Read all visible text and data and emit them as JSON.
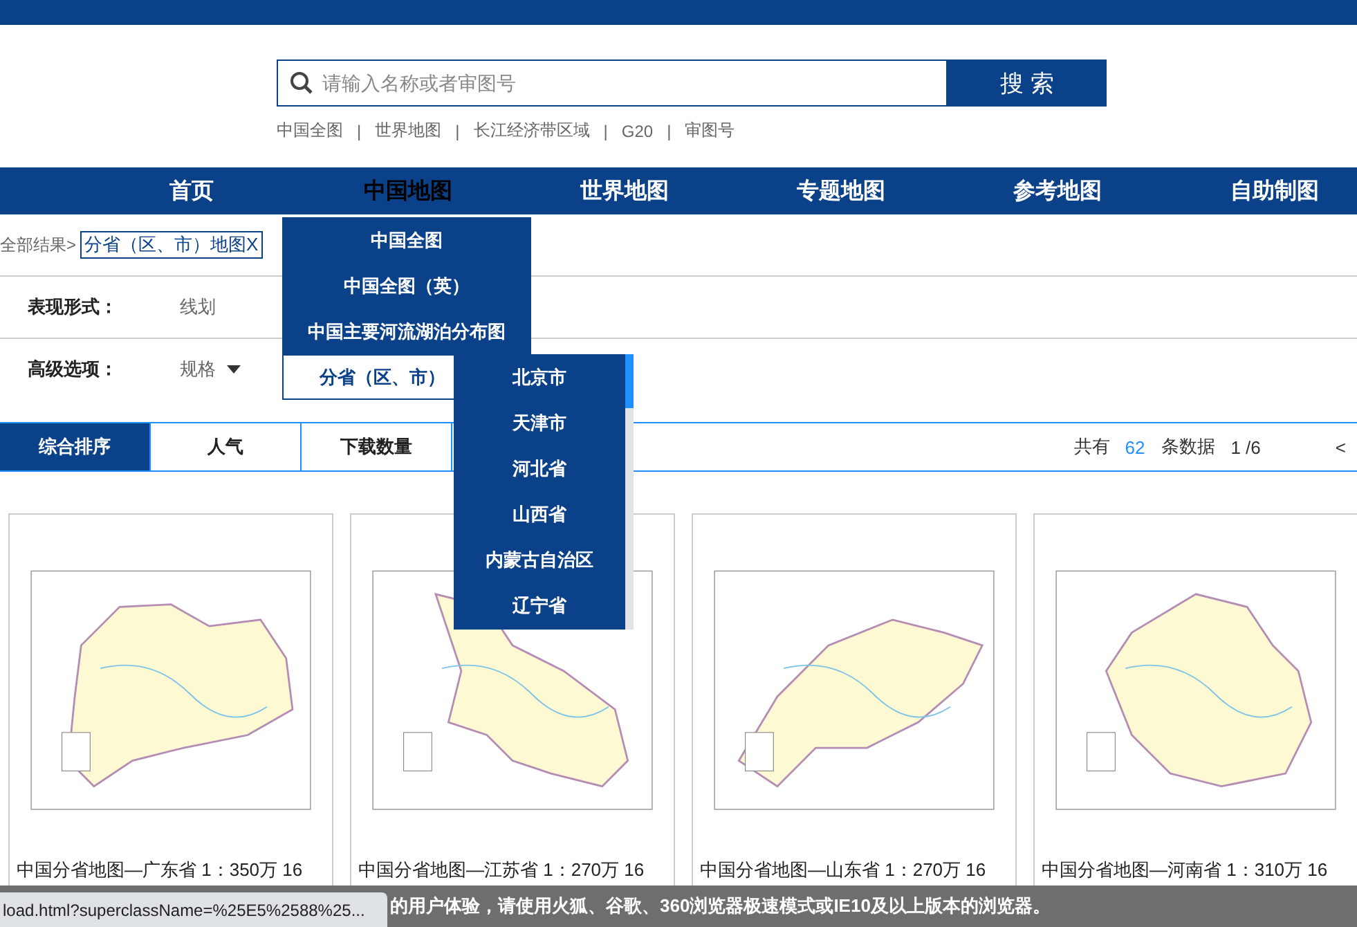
{
  "search": {
    "placeholder": "请输入名称或者审图号",
    "button": "搜 索"
  },
  "quick_links": [
    "中国全图",
    "世界地图",
    "长江经济带区域",
    "G20",
    "审图号"
  ],
  "link_separator": "|",
  "nav": [
    {
      "label": "首页",
      "selected": false
    },
    {
      "label": "中国地图",
      "selected": true
    },
    {
      "label": "世界地图",
      "selected": false
    },
    {
      "label": "专题地图",
      "selected": false
    },
    {
      "label": "参考地图",
      "selected": false
    },
    {
      "label": "自助制图",
      "selected": false
    }
  ],
  "nav_menu": [
    {
      "label": "中国全图",
      "selected": false
    },
    {
      "label": "中国全图（英）",
      "selected": false
    },
    {
      "label": "中国主要河流湖泊分布图",
      "selected": false
    },
    {
      "label": "分省（区、市）",
      "selected": true
    }
  ],
  "submenu": [
    "北京市",
    "天津市",
    "河北省",
    "山西省",
    "内蒙古自治区",
    "辽宁省"
  ],
  "breadcrumb": {
    "prefix": "全部结果>",
    "tag": "分省（区、市）地图X"
  },
  "filters": [
    {
      "label": "表现形式：",
      "value": "线划",
      "dropdown": false
    },
    {
      "label": "高级选项：",
      "value": "规格",
      "dropdown": true
    }
  ],
  "sort_tabs": [
    {
      "label": "综合排序",
      "selected": true
    },
    {
      "label": "人气",
      "selected": false
    },
    {
      "label": "下载数量",
      "selected": false
    }
  ],
  "pagination": {
    "prefix": "共有",
    "total": "62",
    "suffix": "条数据",
    "page": "1 /6",
    "prev": "<"
  },
  "cards": [
    {
      "title": "中国分省地图—广东省 1：350万 16"
    },
    {
      "title": "中国分省地图—江苏省 1：270万 16"
    },
    {
      "title": "中国分省地图—山东省 1：270万 16"
    },
    {
      "title": "中国分省地图—河南省 1：310万 16"
    }
  ],
  "notice": "的用户体验，请使用火狐、谷歌、360浏览器极速模式或IE10及以上版本的浏览器。",
  "status_url": "load.html?superclassName=%25E5%2588%25..."
}
